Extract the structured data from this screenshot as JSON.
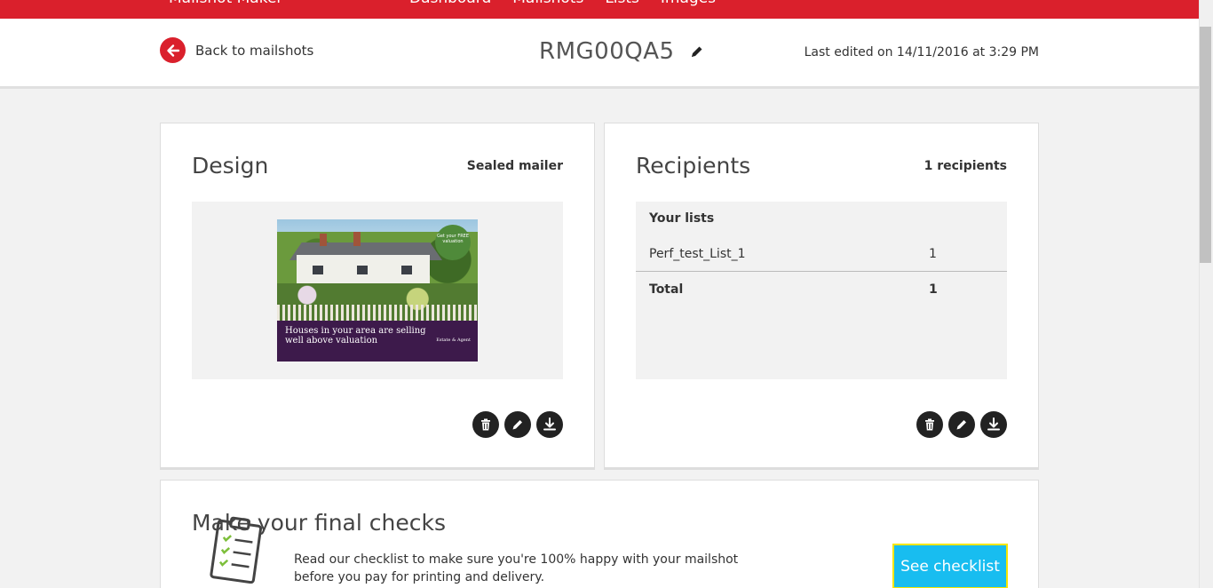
{
  "topbar": {
    "brand": "Mailshot Maker",
    "nav": [
      "Dashboard",
      "Mailshots",
      "Lists",
      "Images"
    ]
  },
  "header": {
    "back_label": "Back to mailshots",
    "title": "RMG00QA5",
    "last_edited": "Last edited on 14/11/2016 at 3:29 PM"
  },
  "design": {
    "heading": "Design",
    "type": "Sealed mailer",
    "preview": {
      "headline": "Houses in your area are selling well above valuation",
      "badge": "Get your FREE valuation",
      "logo": "Estate & Agent"
    }
  },
  "recipients": {
    "heading": "Recipients",
    "count_label": "1 recipients",
    "lists_heading": "Your lists",
    "rows": [
      {
        "name": "Perf_test_List_1",
        "count": "1"
      },
      {
        "name": "Total",
        "count": "1"
      }
    ]
  },
  "checks": {
    "heading": "Make your final checks",
    "text": "Read our checklist to make sure you're 100% happy with your mailshot before you pay for printing and delivery.",
    "button_label": "See checklist"
  },
  "colors": {
    "brand_red": "#da202c",
    "accent_blue": "#18bdf0",
    "focus_yellow": "#f5e600"
  }
}
